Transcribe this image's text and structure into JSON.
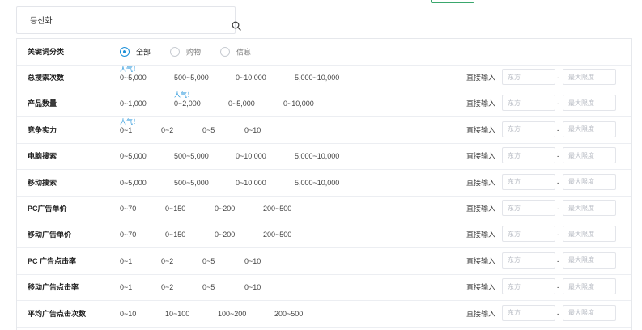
{
  "search": {
    "value": "등산화",
    "placeholder": ""
  },
  "category_filter": {
    "label": "关键词分类",
    "options": [
      {
        "label": "全部",
        "checked": true
      },
      {
        "label": "购物",
        "checked": false
      },
      {
        "label": "信息",
        "checked": false
      }
    ]
  },
  "common": {
    "direct_input_label": "直接输入",
    "min_placeholder": "东方",
    "max_placeholder": "最大限度",
    "range_separator": "-",
    "hot_label": "人气！"
  },
  "rows": [
    {
      "label": "总搜索次数",
      "options": [
        "0~5,000",
        "500~5,000",
        "0~10,000",
        "5,000~10,000"
      ],
      "hot_index": 0
    },
    {
      "label": "产品数量",
      "options": [
        "0~1,000",
        "0~2,000",
        "0~5,000",
        "0~10,000"
      ],
      "hot_index": 1
    },
    {
      "label": "竞争实力",
      "options": [
        "0~1",
        "0~2",
        "0~5",
        "0~10"
      ],
      "hot_index": 0
    },
    {
      "label": "电脑搜索",
      "options": [
        "0~5,000",
        "500~5,000",
        "0~10,000",
        "5,000~10,000"
      ],
      "hot_index": null
    },
    {
      "label": "移动搜索",
      "options": [
        "0~5,000",
        "500~5,000",
        "0~10,000",
        "5,000~10,000"
      ],
      "hot_index": null
    },
    {
      "label": "PC广告单价",
      "options": [
        "0~70",
        "0~150",
        "0~200",
        "200~500"
      ],
      "hot_index": null
    },
    {
      "label": "移动广告单价",
      "options": [
        "0~70",
        "0~150",
        "0~200",
        "200~500"
      ],
      "hot_index": null
    },
    {
      "label": "PC 广告点击率",
      "options": [
        "0~1",
        "0~2",
        "0~5",
        "0~10"
      ],
      "hot_index": null
    },
    {
      "label": "移动广告点击率",
      "options": [
        "0~1",
        "0~2",
        "0~5",
        "0~10"
      ],
      "hot_index": null
    },
    {
      "label": "平均广告点击次数",
      "options": [
        "0~10",
        "10~100",
        "100~200",
        "200~500"
      ],
      "hot_index": null
    }
  ]
}
